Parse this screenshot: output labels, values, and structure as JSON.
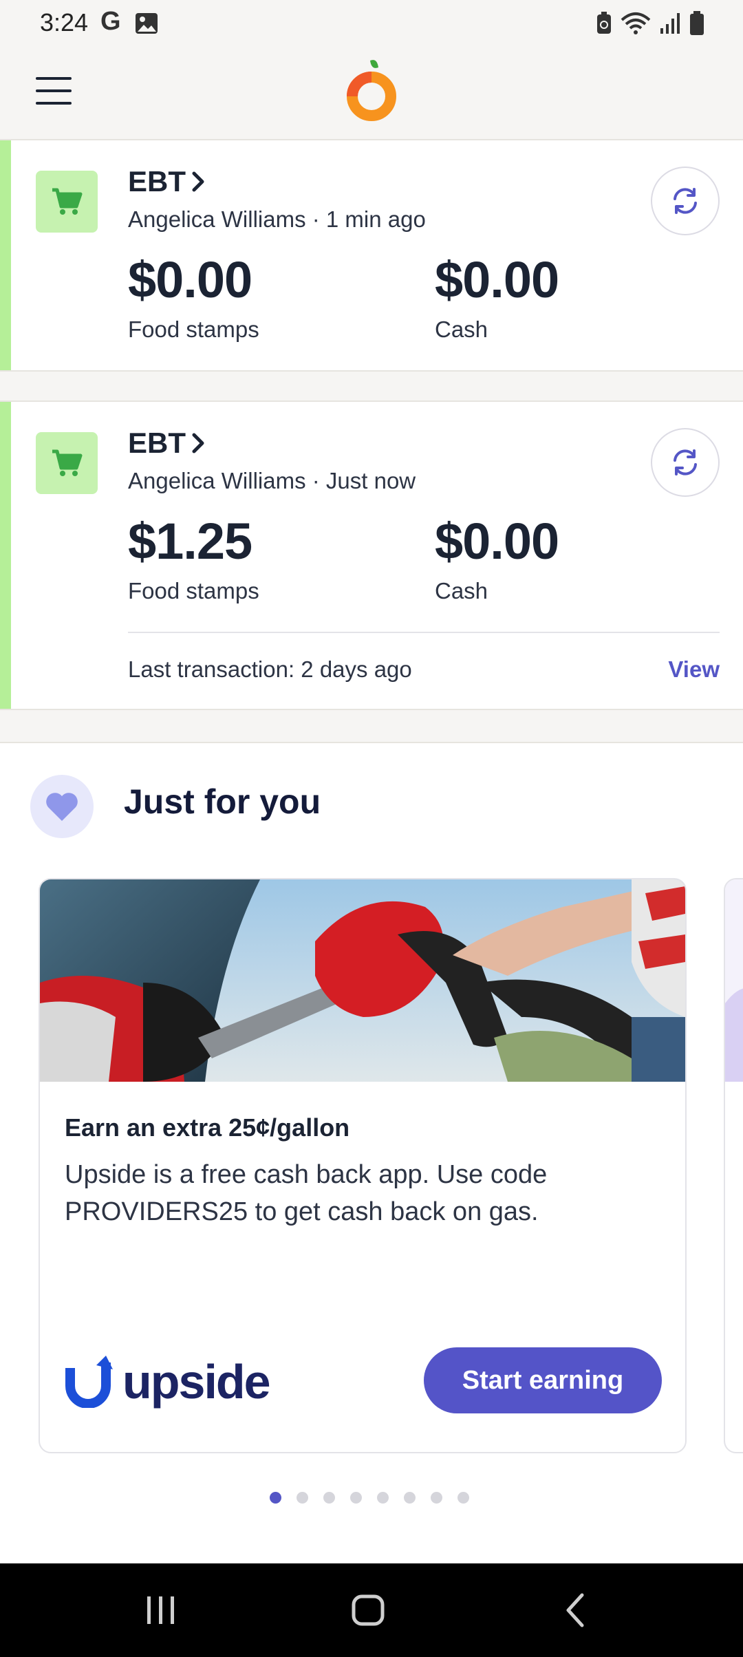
{
  "status_bar": {
    "time": "3:24",
    "google_glyph": "G",
    "icons": [
      "google-icon",
      "image-icon",
      "battery-saver-icon",
      "wifi-icon",
      "signal-icon",
      "battery-icon"
    ]
  },
  "app_bar": {
    "menu_icon": "hamburger-menu-icon",
    "logo": "orange-fruit-logo"
  },
  "cards": [
    {
      "title": "EBT",
      "subtitle": "Angelica Williams · 1 min ago",
      "food_stamps_amount": "$0.00",
      "food_stamps_label": "Food stamps",
      "cash_amount": "$0.00",
      "cash_label": "Cash"
    },
    {
      "title": "EBT",
      "subtitle": "Angelica Williams · Just now",
      "food_stamps_amount": "$1.25",
      "food_stamps_label": "Food stamps",
      "cash_amount": "$0.00",
      "cash_label": "Cash",
      "last_transaction": "Last transaction: 2 days ago",
      "view_label": "View"
    }
  ],
  "just_for_you": {
    "title": "Just for you",
    "promo": {
      "headline": "Earn an extra 25¢/gallon",
      "body": "Upside is a free cash back app. Use code PROVIDERS25 to get cash back on gas.",
      "brand": "upside",
      "cta_label": "Start earning"
    },
    "pagination": {
      "count": 8,
      "active_index": 0
    }
  },
  "colors": {
    "accent_green": "#b5ef98",
    "cart_tile": "#c6f2b0",
    "primary_purple": "#5456c6",
    "text_dark": "#1b2333",
    "background": "#f6f5f3"
  },
  "nav_bar": {
    "icons": [
      "recent-apps-icon",
      "home-icon",
      "back-icon"
    ]
  }
}
